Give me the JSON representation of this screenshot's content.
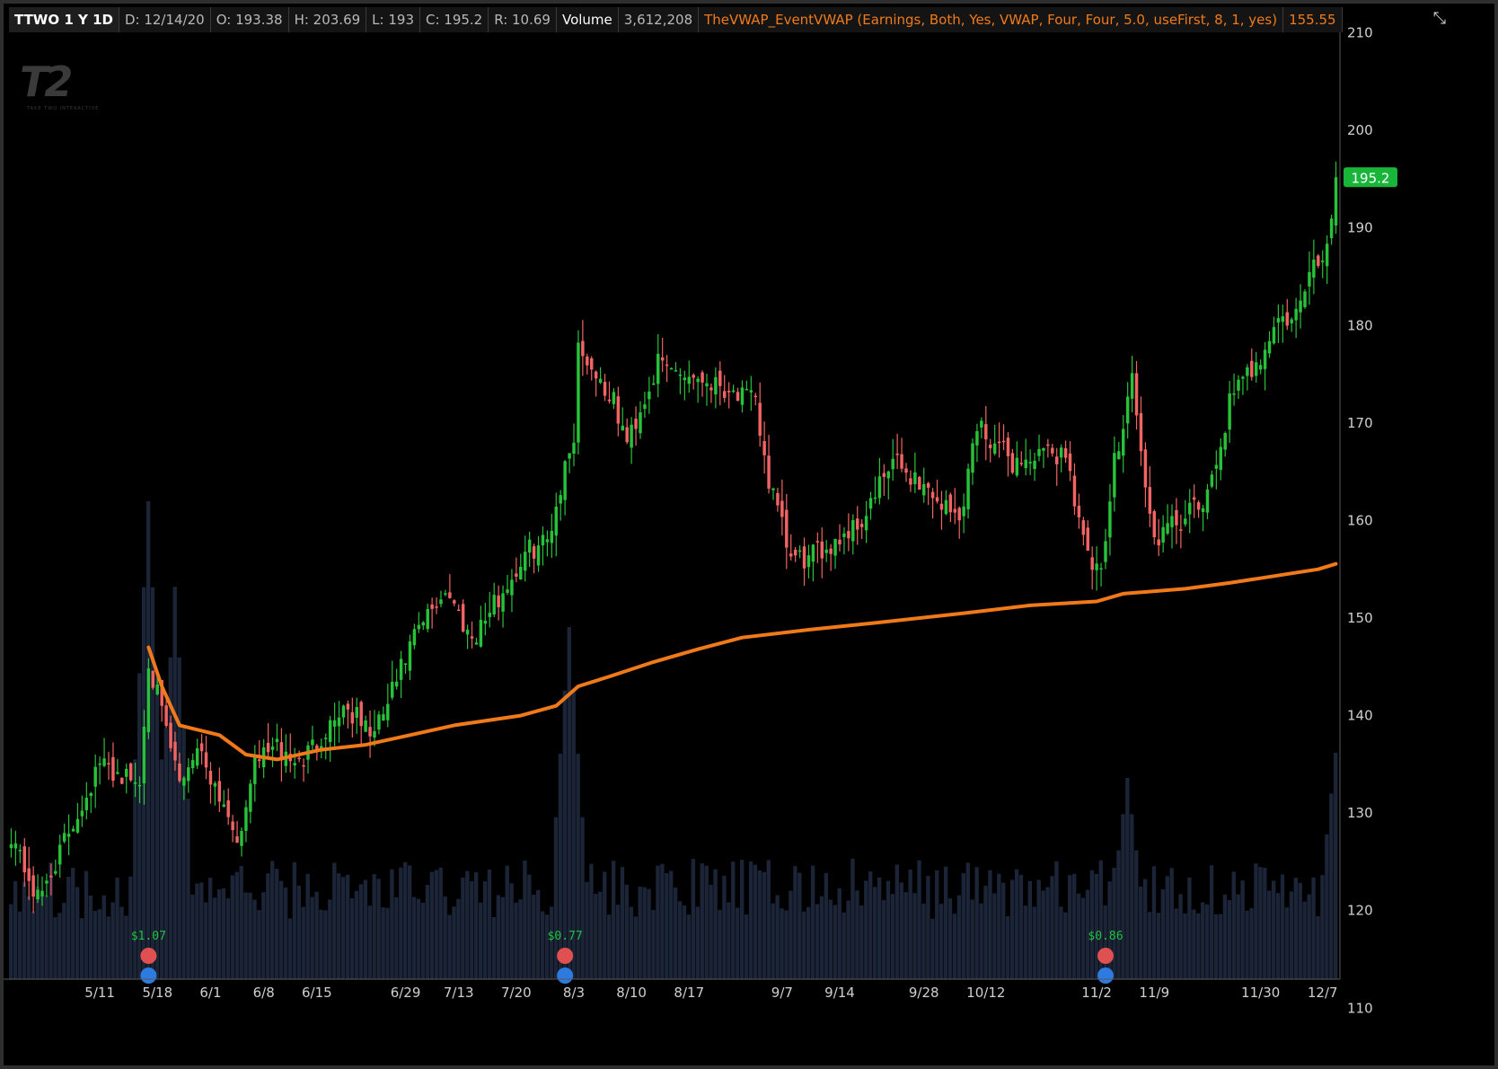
{
  "header": {
    "symbol": "TTWO 1 Y 1D",
    "date": "D: 12/14/20",
    "open": "O: 193.38",
    "high": "H: 203.69",
    "low": "L: 193",
    "close": "C: 195.2",
    "range": "R: 10.69",
    "volume_label": "Volume",
    "volume_value": "3,612,208",
    "indicator": "TheVWAP_EventVWAP (Earnings, Both, Yes, VWAP, Four, Four, 5.0, useFirst, 8, 1, yes)",
    "indicator_value": "155.55"
  },
  "logo": {
    "text": "T2",
    "sub": "TAKE TWO INTERACTIVE"
  },
  "colors": {
    "up": "#27c23a",
    "down": "#f26464",
    "vwap": "#f07a1a",
    "volume": "#1c2538",
    "price_tag": "#19b53a"
  },
  "last_price": "195.2",
  "events": [
    {
      "amount": "$1.07",
      "x_index": 31
    },
    {
      "amount": "$0.77",
      "x_index": 125
    },
    {
      "amount": "$0.86",
      "x_index": 247
    }
  ],
  "chart_data": {
    "type": "candlestick",
    "y_axis": {
      "min": 108,
      "max": 213,
      "ticks": [
        110,
        120,
        130,
        140,
        150,
        160,
        170,
        180,
        190,
        200,
        210
      ]
    },
    "x_axis": {
      "labels": [
        "5/11",
        "5/18",
        "6/1",
        "6/8",
        "6/15",
        "6/29",
        "7/13",
        "7/20",
        "8/3",
        "8/10",
        "8/17",
        "9/7",
        "9/14",
        "9/28",
        "10/12",
        "11/2",
        "11/9",
        "11/30",
        "12/7"
      ]
    },
    "anchors": [
      [
        0,
        128
      ],
      [
        6,
        121
      ],
      [
        10,
        125
      ],
      [
        20,
        135
      ],
      [
        29,
        133
      ],
      [
        31,
        146
      ],
      [
        34,
        140
      ],
      [
        38,
        133
      ],
      [
        42,
        137
      ],
      [
        52,
        127
      ],
      [
        54,
        134
      ],
      [
        58,
        137
      ],
      [
        65,
        135
      ],
      [
        75,
        141
      ],
      [
        82,
        138
      ],
      [
        91,
        148
      ],
      [
        98,
        153
      ],
      [
        104,
        148
      ],
      [
        110,
        152
      ],
      [
        117,
        157
      ],
      [
        121,
        158
      ],
      [
        127,
        169
      ],
      [
        128,
        178
      ],
      [
        136,
        172
      ],
      [
        139,
        168
      ],
      [
        146,
        176
      ],
      [
        160,
        174
      ],
      [
        168,
        172
      ],
      [
        171,
        164
      ],
      [
        176,
        156
      ],
      [
        180,
        156
      ],
      [
        192,
        160
      ],
      [
        199,
        166
      ],
      [
        205,
        164
      ],
      [
        214,
        160
      ],
      [
        218,
        170
      ],
      [
        226,
        166
      ],
      [
        238,
        167
      ],
      [
        243,
        156
      ],
      [
        246,
        154
      ],
      [
        249,
        166
      ],
      [
        253,
        175
      ],
      [
        256,
        163
      ],
      [
        258,
        158
      ],
      [
        264,
        160
      ],
      [
        270,
        162
      ],
      [
        275,
        172
      ],
      [
        282,
        177
      ],
      [
        285,
        180
      ],
      [
        290,
        181
      ],
      [
        294,
        186
      ],
      [
        297,
        188
      ],
      [
        299,
        195.2
      ]
    ],
    "vwap": [
      [
        31,
        147
      ],
      [
        34,
        143
      ],
      [
        38,
        139
      ],
      [
        47,
        138
      ],
      [
        53,
        136
      ],
      [
        60,
        135.5
      ],
      [
        70,
        136.5
      ],
      [
        80,
        137
      ],
      [
        90,
        138
      ],
      [
        100,
        139
      ],
      [
        115,
        140
      ],
      [
        123,
        141
      ],
      [
        128,
        143
      ],
      [
        135,
        144
      ],
      [
        145,
        145.5
      ],
      [
        155,
        146.8
      ],
      [
        165,
        148
      ],
      [
        180,
        148.8
      ],
      [
        195,
        149.5
      ],
      [
        215,
        150.5
      ],
      [
        230,
        151.3
      ],
      [
        245,
        151.7
      ],
      [
        251,
        152.5
      ],
      [
        265,
        153
      ],
      [
        275,
        153.6
      ],
      [
        285,
        154.3
      ],
      [
        295,
        155
      ],
      [
        299,
        155.55
      ]
    ],
    "volume_peaks": [
      [
        31,
        0.95
      ],
      [
        37,
        0.78
      ],
      [
        126,
        0.7
      ],
      [
        252,
        0.4
      ],
      [
        299,
        0.45
      ]
    ]
  }
}
